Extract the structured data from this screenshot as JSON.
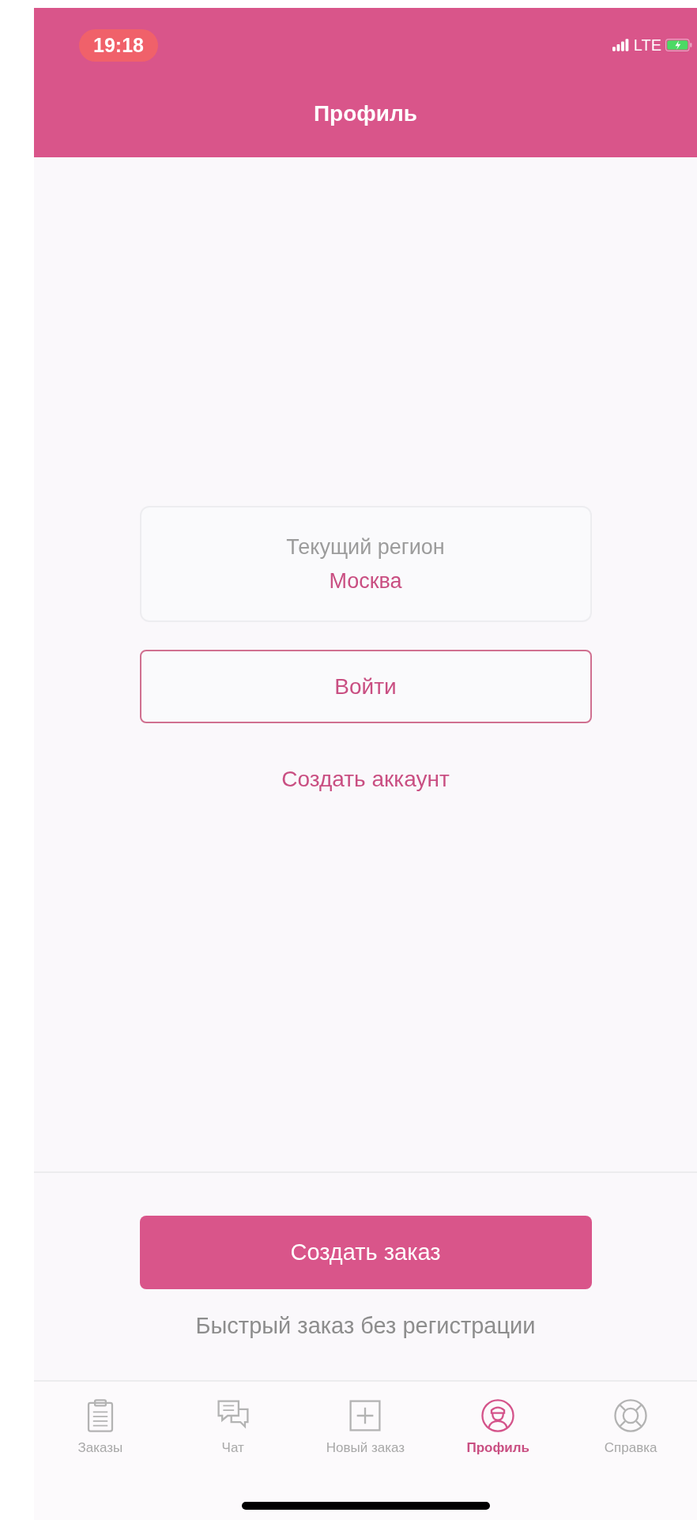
{
  "status_bar": {
    "time": "19:18",
    "recording": true,
    "network": "LTE"
  },
  "header": {
    "title": "Профиль"
  },
  "region": {
    "label": "Текущий регион",
    "value": "Москва"
  },
  "login_button": "Войти",
  "create_account_link": "Создать аккаунт",
  "order_button": "Создать заказ",
  "order_hint": "Быстрый заказ без регистрации",
  "tabs": [
    {
      "kind": "clipboard",
      "label": "Заказы",
      "selected": false
    },
    {
      "kind": "chat",
      "label": "Чат",
      "selected": false
    },
    {
      "kind": "plus",
      "label": "Новый заказ",
      "selected": false
    },
    {
      "kind": "person",
      "label": "Профиль",
      "selected": true
    },
    {
      "kind": "lifebuoy",
      "label": "Справка",
      "selected": false
    }
  ]
}
